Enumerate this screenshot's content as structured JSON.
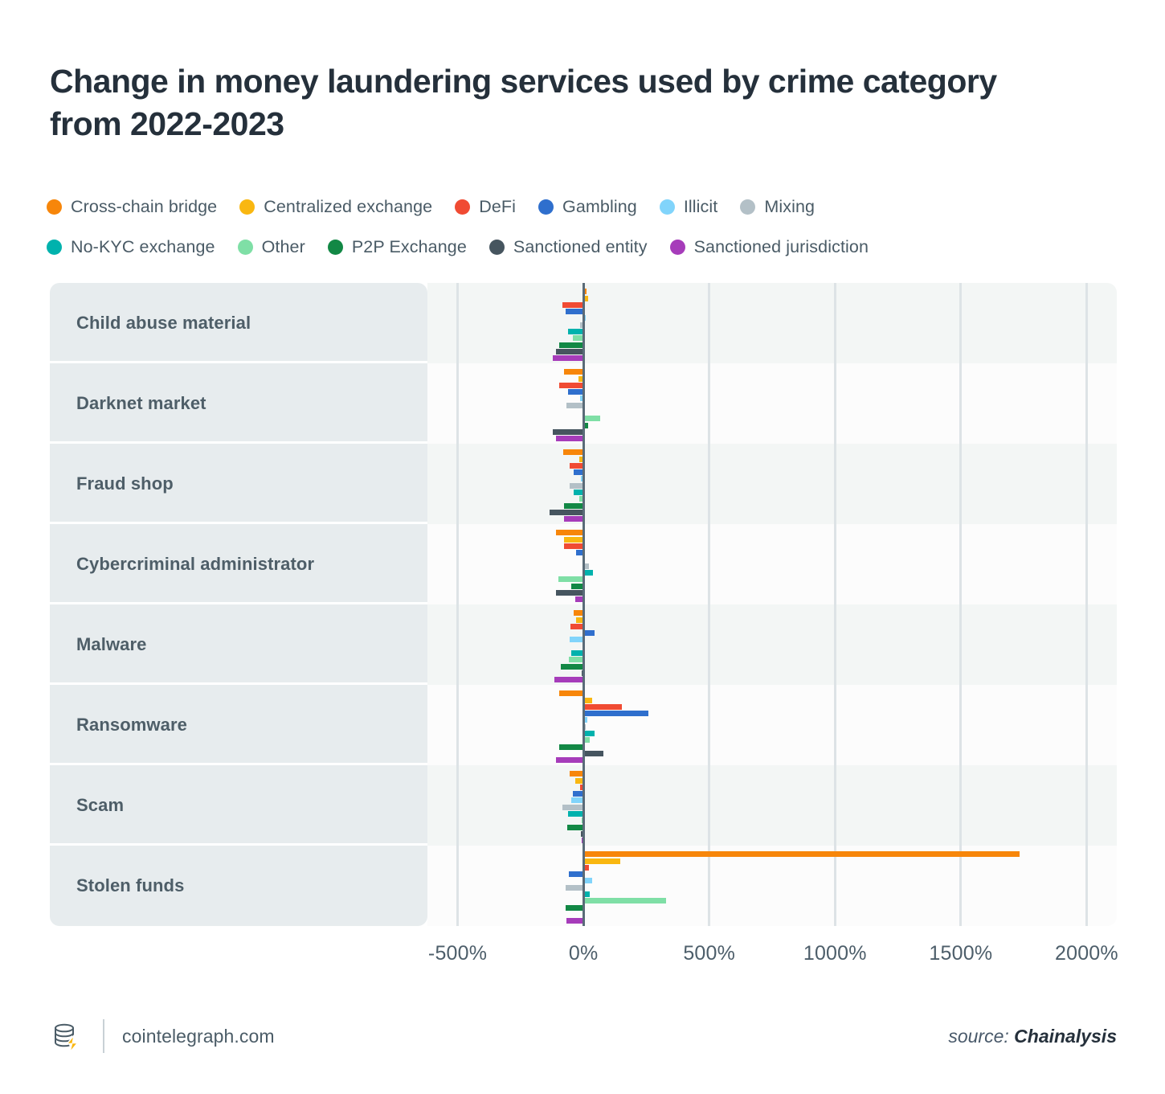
{
  "header": {
    "title": "Change in money laundering services used by crime category from 2022-2023"
  },
  "legend": {
    "rows": [
      [
        {
          "label": "Cross-chain bridge",
          "color": "#f7860a"
        },
        {
          "label": "Centralized exchange",
          "color": "#f9b711"
        },
        {
          "label": "DeFi",
          "color": "#f04b33"
        },
        {
          "label": "Gambling",
          "color": "#2f6fcd"
        },
        {
          "label": "Illicit",
          "color": "#81d4fb"
        },
        {
          "label": "Mixing",
          "color": "#b3c0c7"
        }
      ],
      [
        {
          "label": "No-KYC exchange",
          "color": "#00b2ad"
        },
        {
          "label": "Other",
          "color": "#7fdfa6"
        },
        {
          "label": "P2P Exchange",
          "color": "#128845"
        },
        {
          "label": "Sanctioned entity",
          "color": "#46555f"
        },
        {
          "label": "Sanctioned jurisdiction",
          "color": "#a63cba"
        }
      ]
    ]
  },
  "footer": {
    "brand": "cointelegraph.com",
    "source_prefix": "source:",
    "source_name": "Chainalysis",
    "logo_icon": "cointelegraph-coins-icon"
  },
  "chart_data": {
    "type": "bar",
    "orientation": "horizontal",
    "title": "Change in money laundering services used by crime category from 2022-2023",
    "xlabel": "",
    "ylabel": "",
    "xlim": [
      -620,
      2120
    ],
    "xticks": [
      -500,
      0,
      500,
      1000,
      1500,
      2000
    ],
    "xtick_labels": [
      "-500%",
      "0%",
      "500%",
      "1000%",
      "1500%",
      "2000%"
    ],
    "unit": "%",
    "grid": true,
    "legend_position": "top",
    "categories": [
      "Child abuse material",
      "Darknet market",
      "Fraud shop",
      "Cybercriminal administrator",
      "Malware",
      "Ransomware",
      "Scam",
      "Stolen funds"
    ],
    "series": [
      {
        "name": "Cross-chain bridge",
        "color": "#f7860a",
        "values": [
          12,
          -78,
          -80,
          -110,
          -40,
          -95,
          -55,
          1735
        ]
      },
      {
        "name": "Centralized exchange",
        "color": "#f9b711",
        "values": [
          18,
          -20,
          -18,
          -78,
          -28,
          35,
          -32,
          145
        ]
      },
      {
        "name": "DeFi",
        "color": "#f04b33",
        "values": [
          -85,
          -95,
          -55,
          -78,
          -50,
          153,
          -14,
          22
        ]
      },
      {
        "name": "Gambling",
        "color": "#2f6fcd",
        "values": [
          -72,
          -60,
          -40,
          -28,
          45,
          259,
          -42,
          -58
        ]
      },
      {
        "name": "Illicit",
        "color": "#81d4fb",
        "values": [
          8,
          -12,
          -10,
          5,
          -55,
          15,
          -48,
          35
        ]
      },
      {
        "name": "Mixing",
        "color": "#b3c0c7",
        "values": [
          -14,
          -66,
          -55,
          22,
          7,
          10,
          -85,
          -72
        ]
      },
      {
        "name": "No-KYC exchange",
        "color": "#00b2ad",
        "values": [
          -62,
          -3,
          -40,
          38,
          -48,
          45,
          -60,
          25
        ]
      },
      {
        "name": "Other",
        "color": "#7fdfa6",
        "values": [
          -42,
          66,
          -15,
          -98,
          -58,
          25,
          -8,
          330
        ]
      },
      {
        "name": "P2P Exchange",
        "color": "#128845",
        "values": [
          -95,
          20,
          -78,
          -48,
          -90,
          -95,
          -65,
          -72
        ]
      },
      {
        "name": "Sanctioned entity",
        "color": "#46555f",
        "values": [
          -110,
          -122,
          -135,
          -110,
          -8,
          78,
          -10,
          -5
        ]
      },
      {
        "name": "Sanctioned jurisdiction",
        "color": "#a63cba",
        "values": [
          -122,
          -110,
          -78,
          -32,
          -115,
          -108,
          -8,
          -68
        ]
      }
    ]
  }
}
